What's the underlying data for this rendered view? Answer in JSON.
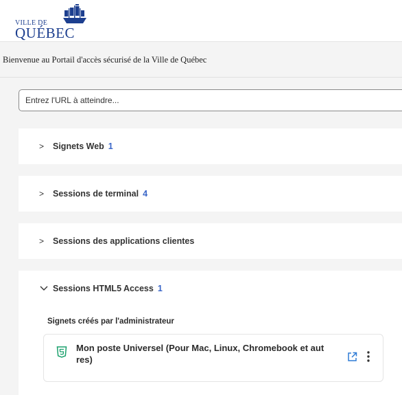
{
  "header": {
    "logo_line1": "VILLE DE",
    "logo_line2": "QUÉBEC"
  },
  "welcome_text": "Bienvenue au Portail d'accès sécurisé de la Ville de Québec",
  "url_input": {
    "placeholder": "Entrez l'URL à atteindre...",
    "value": ""
  },
  "sections": [
    {
      "title": "Signets Web",
      "count": "1",
      "expanded": false
    },
    {
      "title": "Sessions de terminal",
      "count": "4",
      "expanded": false
    },
    {
      "title": "Sessions des applications clientes",
      "count": "",
      "expanded": false
    },
    {
      "title": "Sessions HTML5 Access",
      "count": "1",
      "expanded": true
    }
  ],
  "html5_section": {
    "subheading": "Signets créés par l'administrateur",
    "bookmark": {
      "title_line1": "Mon poste Universel (Pour Mac, Linux, Chromebook et aut",
      "title_line2": "res)"
    }
  },
  "icons": {
    "collapsed": "chevron-right-icon",
    "expanded": "chevron-down-icon",
    "bookmark": "html5-icon",
    "open": "external-link-icon",
    "menu": "more-vertical-icon"
  },
  "colors": {
    "brand_blue": "#1d3f8f",
    "count_blue": "#3a66c8",
    "html5_green": "#1aa06c",
    "external_link_blue": "#2e7bd6",
    "background": "#f4f4f4"
  }
}
